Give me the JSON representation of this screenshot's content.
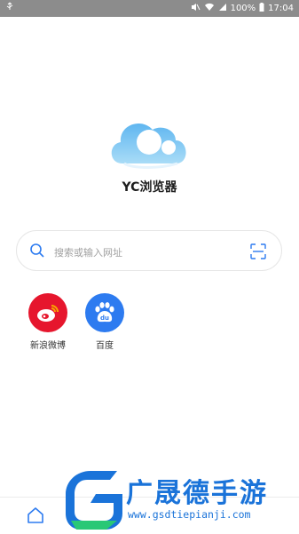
{
  "status_bar": {
    "left_icon": "usb-icon",
    "battery_percent": "100%",
    "time": "17:04",
    "icons": [
      "mute-icon",
      "wifi-icon",
      "signal-icon",
      "battery-icon"
    ]
  },
  "app": {
    "title": "YC浏览器"
  },
  "search": {
    "placeholder": "搜索或输入网址"
  },
  "shortcuts": [
    {
      "label": "新浪微博",
      "icon": "weibo-icon",
      "color": "#e6162d"
    },
    {
      "label": "百度",
      "icon": "baidu-icon",
      "color": "#2d7bf0"
    }
  ],
  "bottom_nav": {
    "home_icon": "home-icon"
  },
  "watermark": {
    "text": "广晟德手游",
    "url": "www.gsdtiepianji.com"
  },
  "colors": {
    "accent": "#2d7bf0",
    "logo": "#7ec4f2"
  }
}
